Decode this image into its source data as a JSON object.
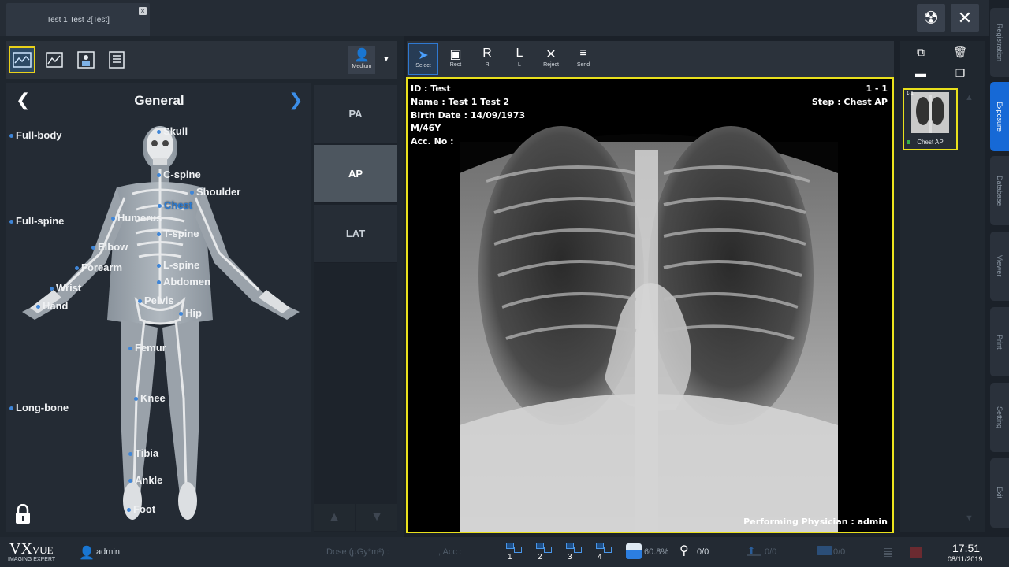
{
  "window": {
    "tab_title": "Test 1 Test 2[Test]",
    "tab_close": "×"
  },
  "top_icons": {
    "radiation": "radiation-icon",
    "fullscreen": "fullscreen-icon"
  },
  "right_nav": [
    "Registration",
    "Exposure",
    "Database",
    "Viewer",
    "Print",
    "Setting",
    "Exit"
  ],
  "right_nav_active": "Exposure",
  "left_toolbar": {
    "medium_label": "Medium"
  },
  "body_selector": {
    "title": "General",
    "groups": [
      "Full-body",
      "Full-spine",
      "Long-bone"
    ],
    "parts": [
      "Skull",
      "C-spine",
      "Shoulder",
      "Chest",
      "Humerus",
      "T-spine",
      "Elbow",
      "Forearm",
      "L-spine",
      "Abdomen",
      "Wrist",
      "Hand",
      "Pelvis",
      "Hip",
      "Femur",
      "Knee",
      "Tibia",
      "Ankle",
      "Foot"
    ],
    "selected": "Chest"
  },
  "views": [
    "PA",
    "AP",
    "LAT"
  ],
  "selected_view": "AP",
  "tools": [
    {
      "label": "Select",
      "glyph": "➤"
    },
    {
      "label": "Rect",
      "glyph": "▣"
    },
    {
      "label": "R",
      "glyph": "R"
    },
    {
      "label": "L",
      "glyph": "L"
    },
    {
      "label": "Reject",
      "glyph": "✕"
    },
    {
      "label": "Send",
      "glyph": "≡"
    }
  ],
  "overlay": {
    "id": "ID : Test",
    "name": "Name : Test 1 Test 2",
    "birth": "Birth Date : 14/09/1973",
    "sex_age": "M/46Y",
    "acc": "Acc. No :",
    "count": "1 - 1",
    "step": "Step : Chest AP",
    "physician": "Performing Physician : admin"
  },
  "thumbnail": {
    "index": "1-1",
    "label": "Chest AP"
  },
  "status": {
    "logo": "VX",
    "logo_sub": "VUE",
    "logo_tag": "IMAGING EXPERT",
    "user": "admin",
    "dose": "Dose (μGy*m²) :",
    "acc": ", Acc :",
    "detectors": [
      "1",
      "2",
      "3",
      "4"
    ],
    "battery": "60.8%",
    "usb": "0/0",
    "upload": "0/0",
    "printer": "0/0",
    "time": "17:51",
    "date": "08/11/2019"
  }
}
